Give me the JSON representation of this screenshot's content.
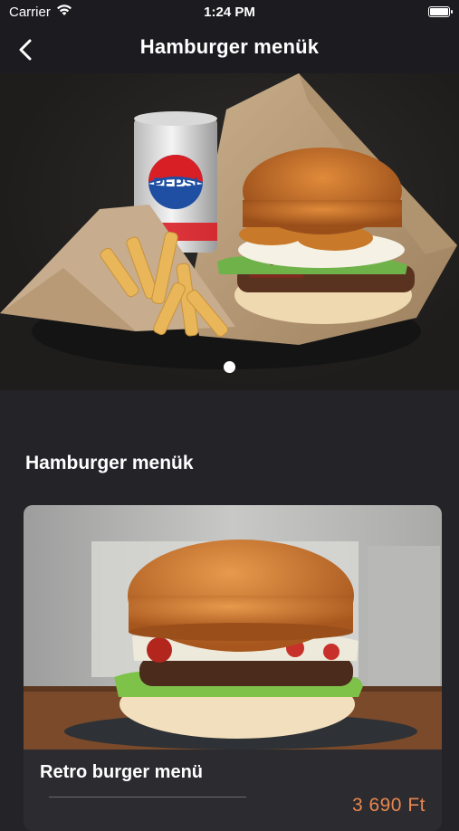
{
  "status": {
    "carrier": "Carrier",
    "time": "1:24 PM"
  },
  "nav": {
    "title": "Hamburger menük"
  },
  "hero": {
    "slide_count": 1,
    "active_slide": 1
  },
  "section": {
    "title": "Hamburger menük"
  },
  "items": [
    {
      "name": "Retro burger menü",
      "price": "3 690 Ft"
    }
  ],
  "colors": {
    "background": "#232328",
    "header": "#1c1c20",
    "card": "#2b2b30",
    "price": "#e8874f"
  }
}
